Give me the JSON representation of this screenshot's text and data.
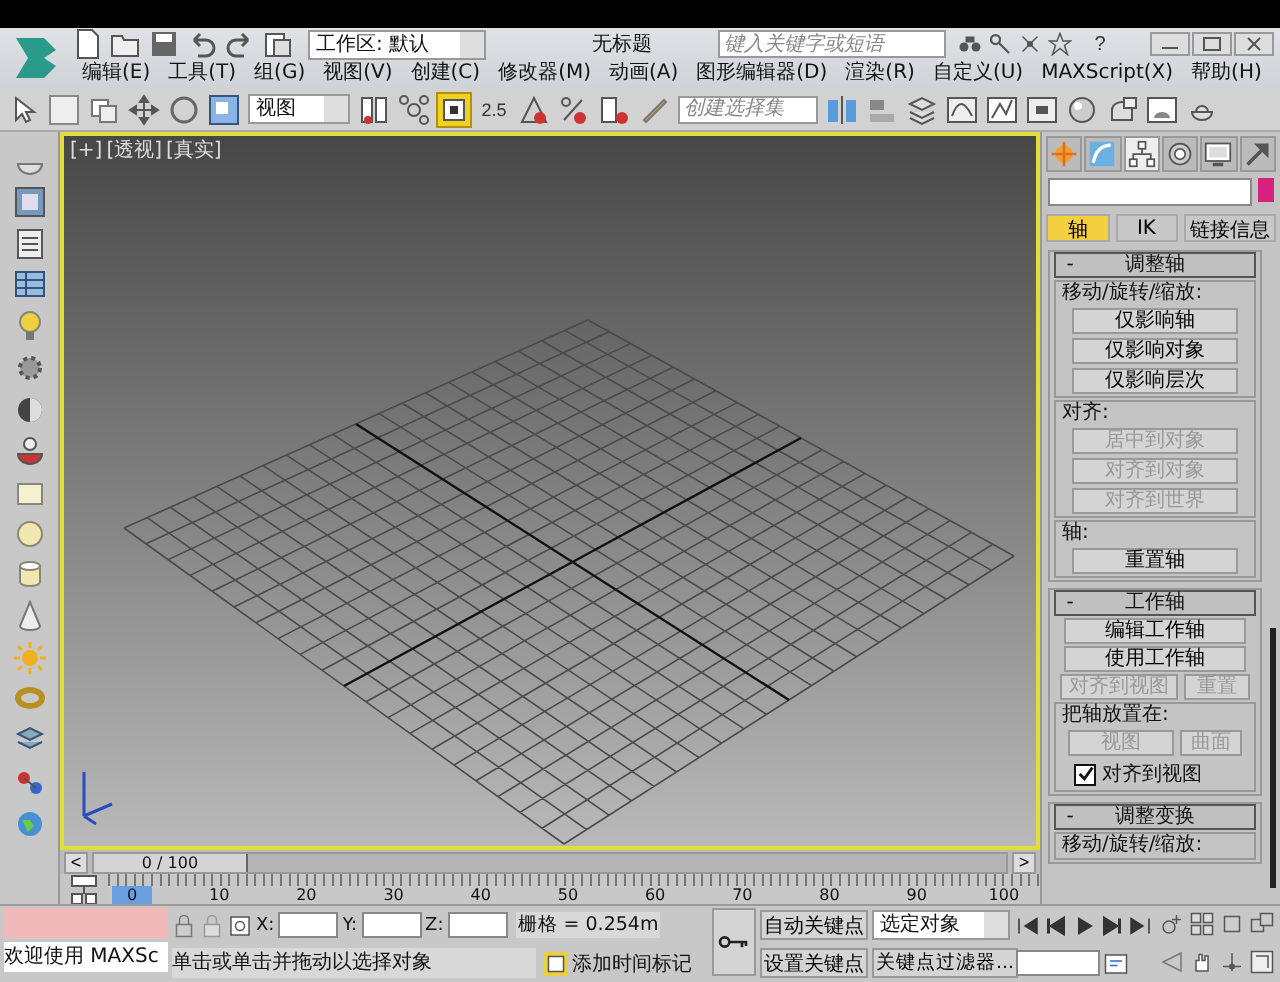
{
  "title_bar": {
    "workspace": "工作区: 默认",
    "title": "无标题",
    "search": {
      "placeholder": "键入关键字或短语"
    },
    "help": "?"
  },
  "menu": [
    "编辑(E)",
    "工具(T)",
    "组(G)",
    "视图(V)",
    "创建(C)",
    "修改器(M)",
    "动画(A)",
    "图形编辑器(D)",
    "渲染(R)",
    "自定义(U)",
    "MAXScript(X)",
    "帮助(H)"
  ],
  "toolbar": {
    "view_dropdown": "视图",
    "snap_label": "2.5",
    "selection_set": {
      "placeholder": "创建选择集"
    }
  },
  "viewport": {
    "labels": [
      "[+]",
      "[透视]",
      "[真实]"
    ]
  },
  "command_panel": {
    "tabs": [
      {
        "selected": false
      },
      {
        "selected": false
      },
      {
        "selected": true
      },
      {
        "selected": false
      },
      {
        "selected": false
      },
      {
        "selected": false
      }
    ],
    "sub_tabs": [
      {
        "label": "轴",
        "selected": true
      },
      {
        "label": "IK",
        "selected": false
      },
      {
        "label": "链接信息",
        "selected": false
      }
    ],
    "rollouts": [
      {
        "toggle": "-",
        "title": "调整轴",
        "items": [
          {
            "kind": "group",
            "title": "移动/旋转/缩放:",
            "items": [
              {
                "kind": "button",
                "label": "仅影响轴",
                "disabled": false
              },
              {
                "kind": "button",
                "label": "仅影响对象",
                "disabled": false
              },
              {
                "kind": "button",
                "label": "仅影响层次",
                "disabled": false
              }
            ]
          },
          {
            "kind": "group",
            "title": "对齐:",
            "items": [
              {
                "kind": "button",
                "label": "居中到对象",
                "disabled": true
              },
              {
                "kind": "button",
                "label": "对齐到对象",
                "disabled": true
              },
              {
                "kind": "button",
                "label": "对齐到世界",
                "disabled": true
              }
            ]
          },
          {
            "kind": "group",
            "title": "轴:",
            "items": [
              {
                "kind": "button",
                "label": "重置轴",
                "disabled": false
              }
            ]
          }
        ]
      },
      {
        "toggle": "-",
        "title": "工作轴",
        "items": [
          {
            "kind": "button",
            "label": "编辑工作轴",
            "disabled": false
          },
          {
            "kind": "button",
            "label": "使用工作轴",
            "disabled": false
          },
          {
            "kind": "button_row",
            "buttons": [
              {
                "label": "对齐到视图",
                "disabled": true
              },
              {
                "label": "重置",
                "disabled": true
              }
            ]
          },
          {
            "kind": "group",
            "title": "把轴放置在:",
            "items": [
              {
                "kind": "button_row",
                "buttons": [
                  {
                    "label": "视图",
                    "disabled": true
                  },
                  {
                    "label": "曲面",
                    "disabled": true
                  }
                ]
              },
              {
                "kind": "checkbox",
                "label": "对齐到视图",
                "checked": true
              }
            ]
          }
        ]
      },
      {
        "toggle": "-",
        "title": "调整变换",
        "items": [
          {
            "kind": "group",
            "title": "移动/旋转/缩放:"
          }
        ]
      }
    ]
  },
  "timeline": {
    "prev": "<",
    "position": "0 / 100",
    "next": ">"
  },
  "ruler": {
    "ticks": [
      {
        "label": "0",
        "current": true
      },
      {
        "label": "10",
        "current": false
      },
      {
        "label": "20",
        "current": false
      },
      {
        "label": "30",
        "current": false
      },
      {
        "label": "40",
        "current": false
      },
      {
        "label": "50",
        "current": false
      },
      {
        "label": "60",
        "current": false
      },
      {
        "label": "70",
        "current": false
      },
      {
        "label": "80",
        "current": false
      },
      {
        "label": "90",
        "current": false
      },
      {
        "label": "100",
        "current": false
      }
    ]
  },
  "status": {
    "maxscript_text": "欢迎使用 MAXSc",
    "coords": [
      "X:",
      "Y:",
      "Z:"
    ],
    "grid": "栅格 = 0.254m",
    "prompt": "单击或单击并拖动以选择对象",
    "add_time_tag": "添加时间标记"
  },
  "animation": {
    "auto_key": "自动关键点",
    "key_mode": "选定对象",
    "set_key": "设置关键点",
    "key_filters": "关键点过滤器..."
  }
}
